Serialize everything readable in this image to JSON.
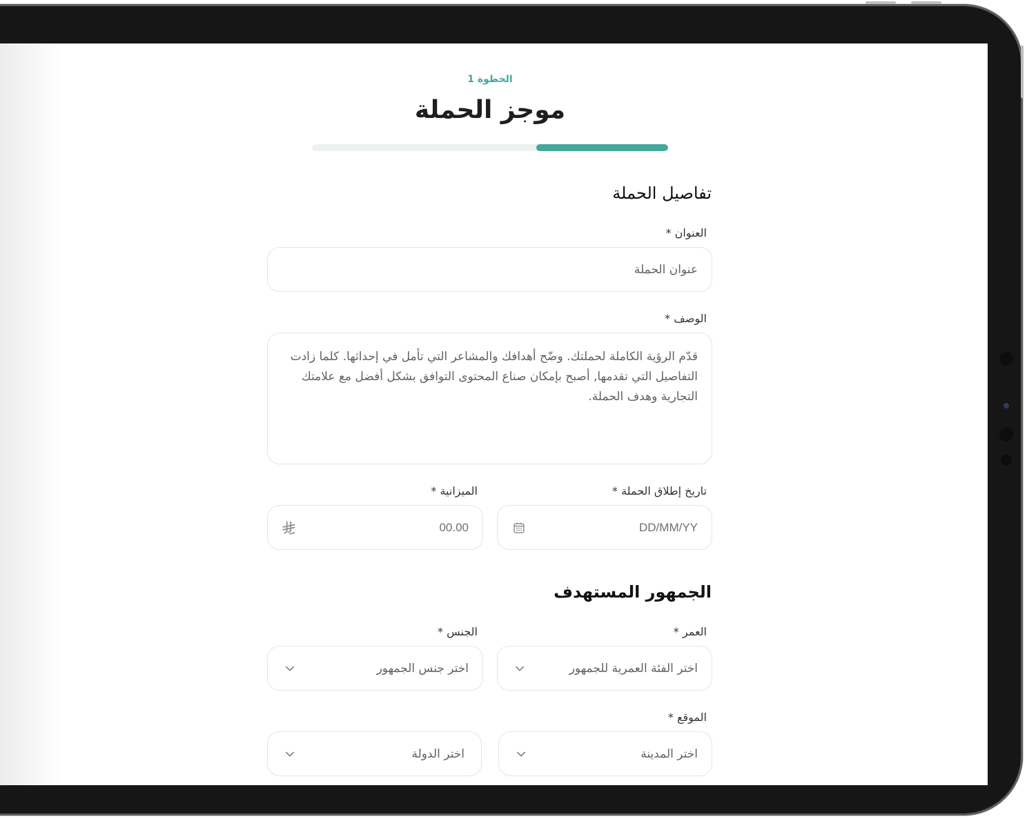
{
  "step": {
    "label": "الخطوة 1",
    "title": "موجز الحملة",
    "progress": 0.37
  },
  "campaign_details": {
    "heading": "تفاصيل الحملة",
    "title_label": "العنوان *",
    "title_placeholder": "عنوان الحملة",
    "description_label": "الوصف *",
    "description_placeholder": "قدّم الرؤية الكاملة لحملتك. وضّح أهدافك والمشاعر التي تأمل في إحداثها. كلما زادت التفاصيل التي تقدمها, أصبح بإمكان صناع المحتوى التوافق بشكل أفضل مع علامتك التجارية وهدف الحملة.",
    "launch_date_label": "تاريخ إطلاق الحملة *",
    "launch_date_placeholder": "DD/MM/YY",
    "budget_label": "الميزانية *",
    "budget_placeholder": "00.00",
    "currency_symbol": "⃁"
  },
  "target_audience": {
    "heading": "الجمهور المستهدف",
    "age_label": "العمر *",
    "age_placeholder": "اختر الفئة العمرية للجمهور",
    "gender_label": "الجنس *",
    "gender_placeholder": "اختر جنس الجمهور",
    "location_label": "الموقع *",
    "city_placeholder": "اختر المدينة",
    "country_placeholder": "اختر الدولة"
  },
  "colors": {
    "accent": "#45a89d",
    "track": "#edf2f1"
  },
  "icons": {
    "calendar": "calendar-icon",
    "chevron": "chevron-down-icon",
    "currency": "riyal-icon"
  }
}
